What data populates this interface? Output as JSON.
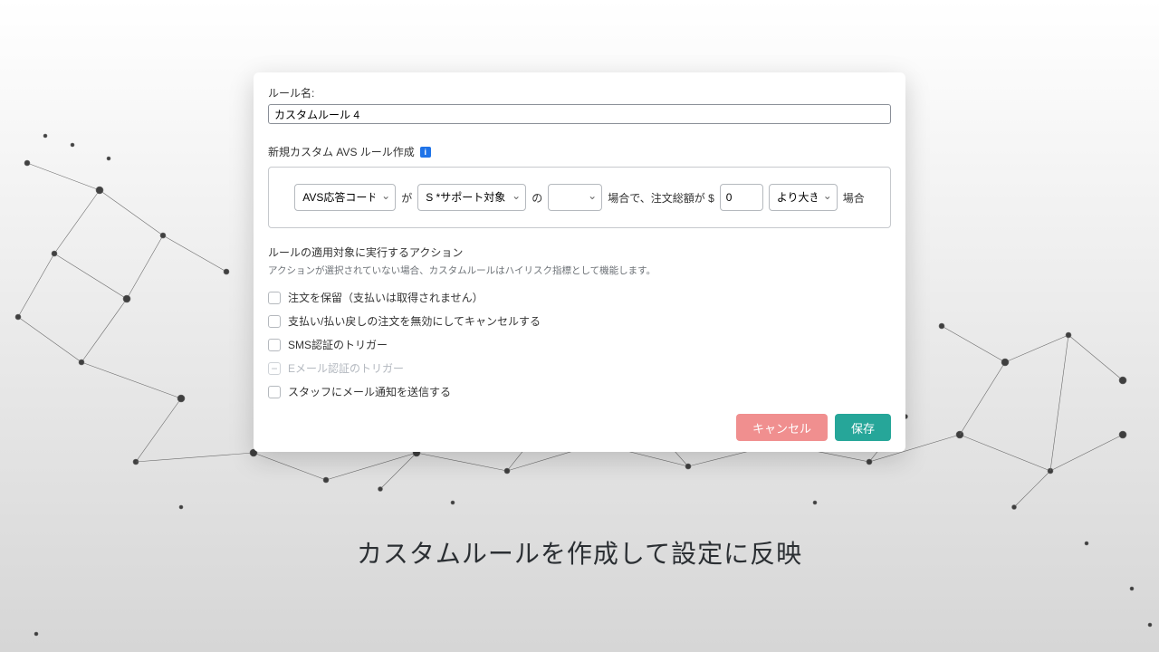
{
  "form": {
    "rule_name_label": "ルール名:",
    "rule_name_value": "カスタムルール 4",
    "new_rule_title": "新規カスタム AVS ルール作成",
    "info_glyph": "i",
    "select_avs": "AVS応答コード",
    "txt_ga": "が",
    "select_support": "S *サポート対象外",
    "txt_no": "の",
    "select_blank": "",
    "txt_case_total": "場合で、注文総額が $",
    "amount_value": "0",
    "select_gt": "より大きい",
    "txt_case": "場合",
    "actions_title": "ルールの適用対象に実行するアクション",
    "actions_hint": "アクションが選択されていない場合、カスタムルールはハイリスク指標として機能します。"
  },
  "checks": {
    "hold": "注文を保留（支払いは取得されません）",
    "void": "支払い/払い戻しの注文を無効にしてキャンセルする",
    "sms": "SMS認証のトリガー",
    "email": "Eメール認証のトリガー",
    "notify": "スタッフにメール通知を送信する"
  },
  "buttons": {
    "cancel": "キャンセル",
    "save": "保存"
  },
  "caption": "カスタムルールを作成して設定に反映"
}
